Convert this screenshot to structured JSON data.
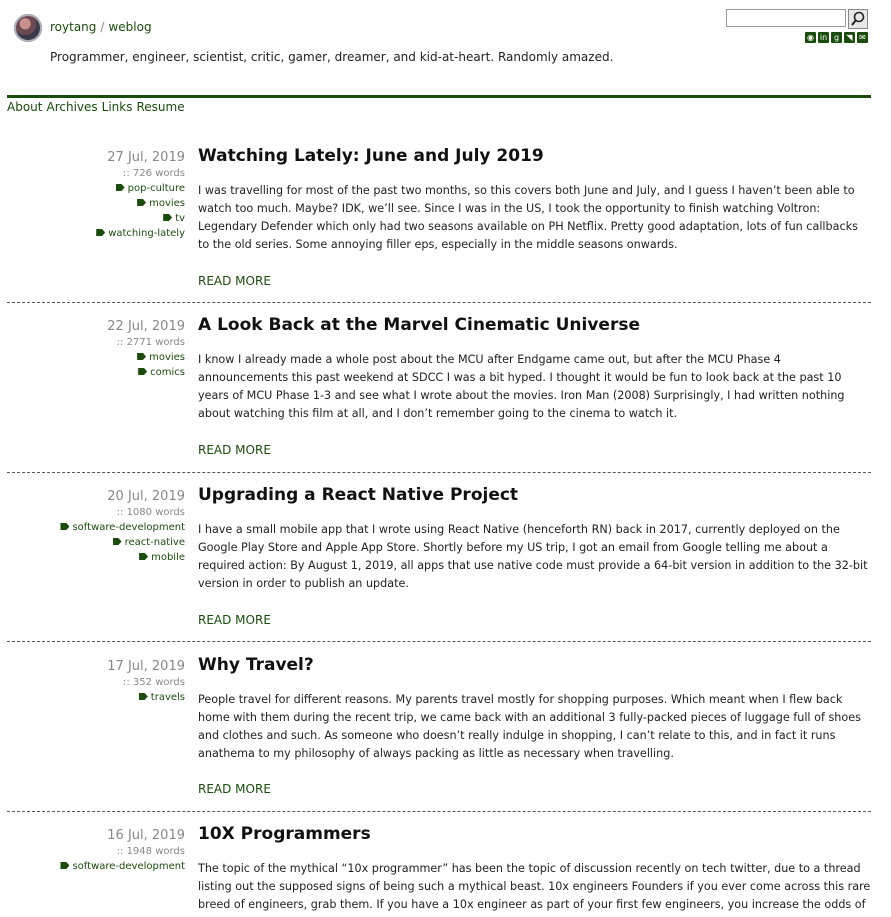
{
  "site": {
    "owner": "roytang",
    "section": "weblog",
    "separator": "/",
    "tagline": "Programmer, engineer, scientist, critic, gamer, dreamer, and kid-at-heart. Randomly amazed."
  },
  "search": {
    "value": "",
    "button_icon": "search-icon"
  },
  "social_icons": [
    "github-icon",
    "linkedin-icon",
    "goodreads-icon",
    "rss-icon",
    "email-icon"
  ],
  "nav": [
    "About",
    "Archives",
    "Links",
    "Resume"
  ],
  "read_more_label": "READ MORE",
  "posts": [
    {
      "date": "27 Jul, 2019",
      "words": ":: 726 words",
      "tags": [
        "pop-culture",
        "movies",
        "tv",
        "watching-lately"
      ],
      "title": "Watching Lately: June and July 2019",
      "excerpt": "I was travelling for most of the past two months, so this covers both June and July, and I guess I haven’t been able to watch too much. Maybe? IDK, we’ll see. Since I was in the US, I took the opportunity to finish watching Voltron: Legendary Defender which only had two seasons available on PH Netflix. Pretty good adaptation, lots of fun callbacks to the old series. Some annoying filler eps, especially in the middle seasons onwards."
    },
    {
      "date": "22 Jul, 2019",
      "words": ":: 2771 words",
      "tags": [
        "movies",
        "comics"
      ],
      "title": "A Look Back at the Marvel Cinematic Universe",
      "excerpt": "I know I already made a whole post about the MCU after Endgame came out, but after the MCU Phase 4 announcements this past weekend at SDCC I was a bit hyped. I thought it would be fun to look back at the past 10 years of MCU Phase 1-3 and see what I wrote about the movies. Iron Man (2008) Surprisingly, I had written nothing about watching this film at all, and I don’t remember going to the cinema to watch it."
    },
    {
      "date": "20 Jul, 2019",
      "words": ":: 1080 words",
      "tags": [
        "software-development",
        "react-native",
        "mobile"
      ],
      "title": "Upgrading a React Native Project",
      "excerpt": "I have a small mobile app that I wrote using React Native (henceforth RN) back in 2017, currently deployed on the Google Play Store and Apple App Store. Shortly before my US trip, I got an email from Google telling me about a required action: By August 1, 2019, all apps that use native code must provide a 64-bit version in addition to the 32-bit version in order to publish an update."
    },
    {
      "date": "17 Jul, 2019",
      "words": ":: 352 words",
      "tags": [
        "travels"
      ],
      "title": "Why Travel?",
      "excerpt": "People travel for different reasons. My parents travel mostly for shopping purposes. Which meant when I flew back home with them during the recent trip, we came back with an additional 3 fully-packed pieces of luggage full of shoes and clothes and such. As someone who doesn’t really indulge in shopping, I can’t relate to this, and in fact it runs anathema to my philosophy of always packing as little as necessary when travelling."
    },
    {
      "date": "16 Jul, 2019",
      "words": ":: 1948 words",
      "tags": [
        "software-development"
      ],
      "title": "10X Programmers",
      "excerpt": "The topic of the mythical “10x programmer” has been the topic of discussion recently on tech twitter, due to a thread listing out the supposed signs of being such a mythical beast. 10x engineers Founders if you ever come across this rare breed of engineers, grab them. If you have a 10x engineer as part of your first few engineers, you increase the odds of"
    }
  ]
}
